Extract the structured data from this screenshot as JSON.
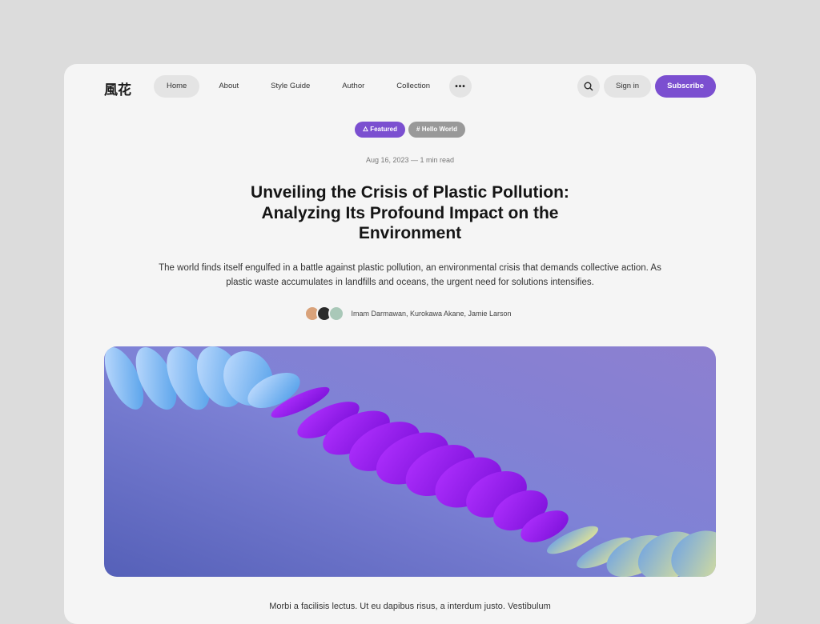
{
  "brand": {
    "logo": "風花"
  },
  "nav": {
    "items": [
      "Home",
      "About",
      "Style Guide",
      "Author",
      "Collection"
    ],
    "more_icon": "ellipsis-icon"
  },
  "header": {
    "search_icon": "search-icon",
    "sign_in": "Sign in",
    "subscribe": "Subscribe"
  },
  "tags": [
    {
      "label": "Featured",
      "icon": "flame-icon",
      "color": "#7b4fd0"
    },
    {
      "label": "Hello World",
      "icon": "hash-icon",
      "color": "#999999"
    }
  ],
  "article": {
    "meta": "Aug 16, 2023 — 1 min read",
    "title": "Unveiling the Crisis of Plastic Pollution: Analyzing Its Profound Impact on the Environment",
    "lede": "The world finds itself engulfed in a battle against plastic pollution, an environmental crisis that demands collective action. As plastic waste accumulates in landfills and oceans, the urgent need for solutions intensifies.",
    "authors": "Imam Darmawan, Kurokawa Akane, Jamie Larson",
    "body_start": "Morbi a facilisis lectus. Ut eu dapibus risus, a interdum justo. Vestibulum"
  },
  "colors": {
    "accent": "#7b4fd0"
  }
}
